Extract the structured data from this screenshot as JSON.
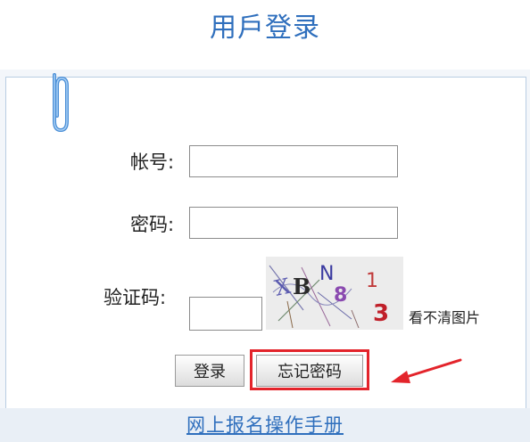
{
  "header": {
    "title": "用戶登录"
  },
  "form": {
    "account_label": "帐号:",
    "account_value": "",
    "password_label": "密码:",
    "password_value": "",
    "captcha_label": "验证码:",
    "captcha_value": "",
    "captcha_chars": [
      "X",
      "B",
      "N",
      "8",
      "1",
      "3"
    ],
    "captcha_hint": "看不清图片"
  },
  "buttons": {
    "login_label": "登录",
    "forgot_password_label": "忘记密码"
  },
  "footer": {
    "manual_link": "网上报名操作手册"
  },
  "colors": {
    "title_blue": "#2f6fbd",
    "highlight_red": "#e3242b",
    "panel_border": "#b9cde3"
  }
}
